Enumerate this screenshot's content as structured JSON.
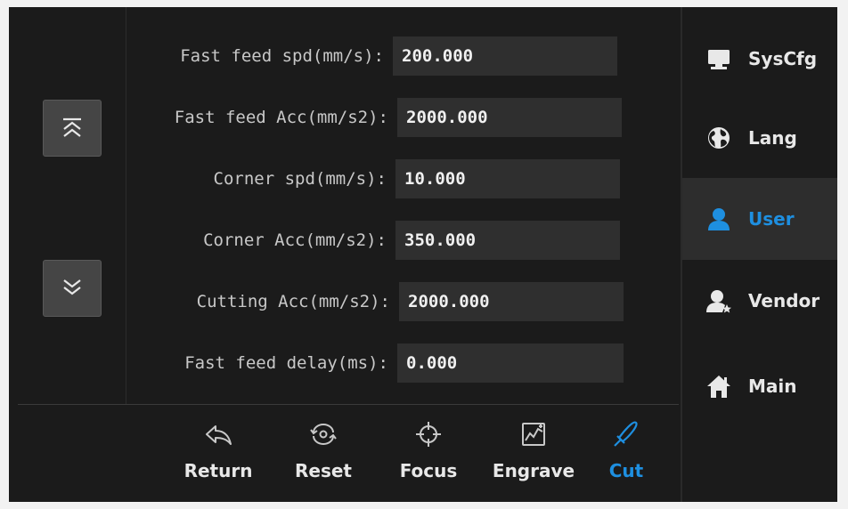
{
  "params": [
    {
      "label": "Fast feed spd(mm/s):",
      "value": "200.000"
    },
    {
      "label": "Fast feed Acc(mm/s2):",
      "value": "2000.000"
    },
    {
      "label": "Corner spd(mm/s):",
      "value": "10.000"
    },
    {
      "label": "Corner Acc(mm/s2):",
      "value": "350.000"
    },
    {
      "label": "Cutting Acc(mm/s2):",
      "value": "2000.000"
    },
    {
      "label": "Fast feed delay(ms):",
      "value": "0.000"
    }
  ],
  "paging": {
    "up_icon": "double-chevron-up-icon",
    "down_icon": "double-chevron-down-icon"
  },
  "bottom_bar": [
    {
      "label": "Return",
      "icon": "return-arrow-icon"
    },
    {
      "label": "Reset",
      "icon": "reset-icon"
    },
    {
      "label": "Focus",
      "icon": "crosshair-icon"
    },
    {
      "label": "Engrave",
      "icon": "engrave-icon"
    },
    {
      "label": "Cut",
      "icon": "knife-icon",
      "active": true
    }
  ],
  "side_menu": [
    {
      "label": "SysCfg",
      "icon": "monitor-icon"
    },
    {
      "label": "Lang",
      "icon": "globe-icon"
    },
    {
      "label": "User",
      "icon": "user-icon",
      "active": true
    },
    {
      "label": "Vendor",
      "icon": "vendor-icon"
    },
    {
      "label": "Main",
      "icon": "home-icon"
    }
  ],
  "colors": {
    "accent": "#1e8fe0",
    "background": "#1b1b1b",
    "field": "#2f2f2f",
    "text": "#c8c8c8"
  }
}
